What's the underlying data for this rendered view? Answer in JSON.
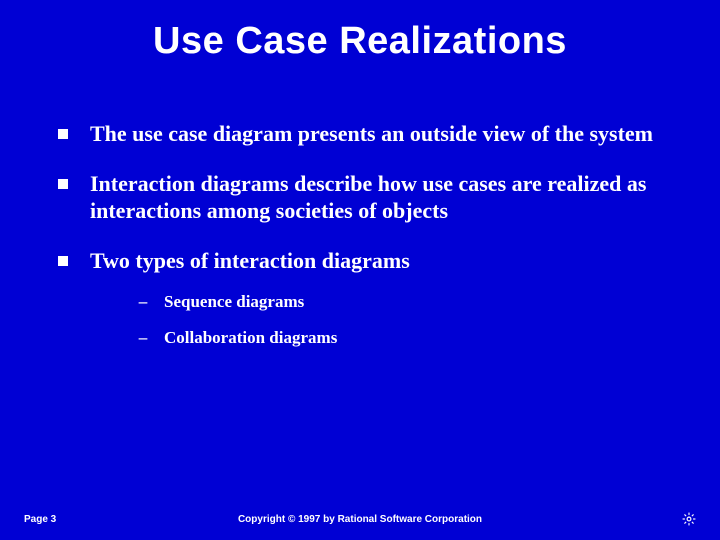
{
  "title": "Use Case Realizations",
  "bullets": [
    {
      "text": "The use case diagram presents an outside view of the system"
    },
    {
      "text": "Interaction diagrams describe how use cases are realized as interactions among societies of objects"
    },
    {
      "text": "Two types of interaction diagrams"
    }
  ],
  "sub_bullets": [
    {
      "text": "Sequence diagrams"
    },
    {
      "text": "Collaboration diagrams"
    }
  ],
  "footer": {
    "page": "Page 3",
    "copyright": "Copyright © 1997 by Rational Software Corporation"
  }
}
